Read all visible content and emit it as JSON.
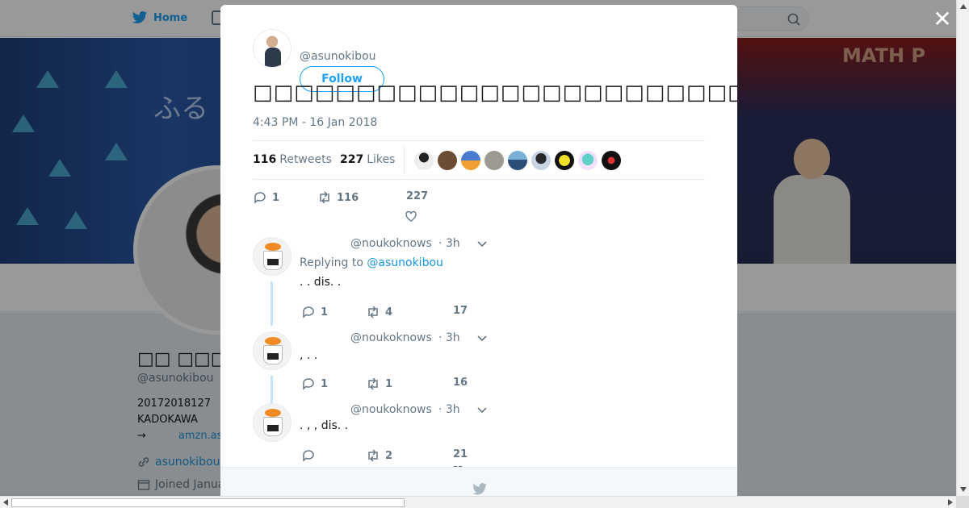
{
  "nav": {
    "home_label": "Home",
    "search_icon": "search-icon"
  },
  "background": {
    "name": "□□ □□□",
    "handle": "@asunokibou",
    "bio_line1": "20172018127",
    "bio_line2": "KADOKAWA",
    "bio_arrow": "→",
    "bio_link": "amzn.as",
    "website": "asunokibou",
    "joined": "Joined Janua"
  },
  "modal": {
    "author_handle": "@asunokibou",
    "follow_label": "Follow",
    "tweet_text": "□□□□□□□□□□□□□□□□□□□□□□□□□ □□□□□□□□□□□□□□□□□□□□□□□□□□□□□",
    "timestamp": "4:43 PM - 16 Jan 2018",
    "retweets_count": "116",
    "retweets_label": "Retweets",
    "likes_count": "227",
    "likes_label": "Likes",
    "actions": {
      "replies": "1",
      "retweets": "116",
      "likes": "227"
    }
  },
  "replies": [
    {
      "handle": "@noukoknows",
      "time": "· 3h",
      "replying_prefix": "Replying to",
      "replying_to": "@asunokibou",
      "text": ". . dis. .",
      "replies": "1",
      "retweets": "4",
      "likes": "17"
    },
    {
      "handle": "@noukoknows",
      "time": "· 3h",
      "text": ", . .",
      "replies": "1",
      "retweets": "1",
      "likes": "16"
    },
    {
      "handle": "@noukoknows",
      "time": "· 3h",
      "text": ". , , dis. .",
      "replies": "",
      "retweets": "2",
      "likes": "21"
    }
  ],
  "colors": {
    "accent": "#1da1f2",
    "link": "#1b95e0",
    "muted": "#657786"
  }
}
